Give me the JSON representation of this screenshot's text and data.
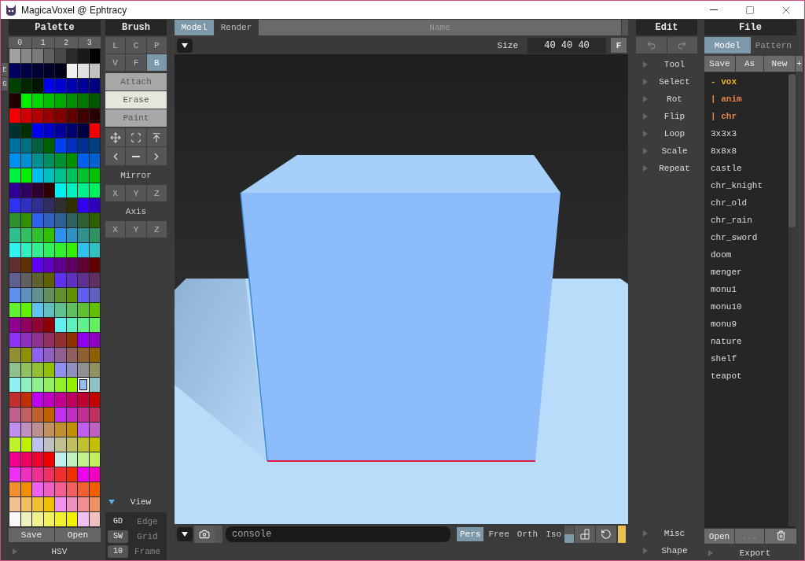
{
  "window": {
    "title": "MagicaVoxel @ Ephtracy"
  },
  "palette": {
    "title": "Palette",
    "side_tabs": [
      "E",
      "G"
    ],
    "tabs": [
      "0",
      "1",
      "2",
      "3"
    ],
    "rows": [
      {
        "swatches": [
          {
            "color": "#a0a0a0",
            "selected": false
          },
          {
            "color": "#888888",
            "selected": false
          },
          {
            "color": "#7a7a7a",
            "selected": false
          },
          {
            "color": "#606060",
            "selected": false
          },
          {
            "color": "#4a4a4a",
            "selected": false
          },
          {
            "color": "#2a2a2a",
            "selected": false
          },
          {
            "color": "#181818",
            "selected": false
          },
          {
            "color": "#000000",
            "selected": false
          }
        ]
      },
      {
        "swatches": [
          {
            "color": "#000060",
            "selected": false
          },
          {
            "color": "#000048",
            "selected": false
          },
          {
            "color": "#000038",
            "selected": false
          },
          {
            "color": "#000028",
            "selected": false
          },
          {
            "color": "#000018",
            "selected": false
          },
          {
            "color": "#f0f0f0",
            "selected": false
          },
          {
            "color": "#e0e0e0",
            "selected": false
          },
          {
            "color": "#c0c0c0",
            "selected": false
          }
        ]
      },
      {
        "swatches": [
          {
            "color": "#004000",
            "selected": false
          },
          {
            "color": "#002800",
            "selected": false
          },
          {
            "color": "#001800",
            "selected": false
          },
          {
            "color": "#0000f0",
            "selected": false
          },
          {
            "color": "#0000d0",
            "selected": false
          },
          {
            "color": "#0000b0",
            "selected": false
          },
          {
            "color": "#000098",
            "selected": false
          },
          {
            "color": "#000080",
            "selected": false
          }
        ]
      },
      {
        "swatches": [
          {
            "color": "#200000",
            "selected": false
          },
          {
            "color": "#00f000",
            "selected": false
          },
          {
            "color": "#00d800",
            "selected": false
          },
          {
            "color": "#00c000",
            "selected": false
          },
          {
            "color": "#00a800",
            "selected": false
          },
          {
            "color": "#009000",
            "selected": false
          },
          {
            "color": "#007800",
            "selected": false
          },
          {
            "color": "#005800",
            "selected": false
          }
        ]
      },
      {
        "swatches": [
          {
            "color": "#f00000",
            "selected": false
          },
          {
            "color": "#d00000",
            "selected": false
          },
          {
            "color": "#b00000",
            "selected": false
          },
          {
            "color": "#980000",
            "selected": false
          },
          {
            "color": "#800000",
            "selected": false
          },
          {
            "color": "#600000",
            "selected": false
          },
          {
            "color": "#400000",
            "selected": false
          },
          {
            "color": "#280000",
            "selected": false
          }
        ]
      },
      {
        "swatches": [
          {
            "color": "#003030",
            "selected": false
          },
          {
            "color": "#003000",
            "selected": false
          },
          {
            "color": "#0000f8",
            "selected": false
          },
          {
            "color": "#0000c8",
            "selected": false
          },
          {
            "color": "#000098",
            "selected": false
          },
          {
            "color": "#000070",
            "selected": false
          },
          {
            "color": "#000040",
            "selected": false
          },
          {
            "color": "#f00000",
            "selected": false
          }
        ]
      },
      {
        "swatches": [
          {
            "color": "#0070a0",
            "selected": false
          },
          {
            "color": "#007080",
            "selected": false
          },
          {
            "color": "#006040",
            "selected": false
          },
          {
            "color": "#006000",
            "selected": false
          },
          {
            "color": "#0040f0",
            "selected": false
          },
          {
            "color": "#0030c0",
            "selected": false
          },
          {
            "color": "#003090",
            "selected": false
          },
          {
            "color": "#004080",
            "selected": false
          }
        ]
      },
      {
        "swatches": [
          {
            "color": "#0090f0",
            "selected": false
          },
          {
            "color": "#0090d0",
            "selected": false
          },
          {
            "color": "#009090",
            "selected": false
          },
          {
            "color": "#009060",
            "selected": false
          },
          {
            "color": "#009030",
            "selected": false
          },
          {
            "color": "#009000",
            "selected": false
          },
          {
            "color": "#0060f0",
            "selected": false
          },
          {
            "color": "#0060d0",
            "selected": false
          }
        ]
      },
      {
        "swatches": [
          {
            "color": "#00f040",
            "selected": false
          },
          {
            "color": "#00f000",
            "selected": false
          },
          {
            "color": "#00c0f0",
            "selected": false
          },
          {
            "color": "#00c0c0",
            "selected": false
          },
          {
            "color": "#00c090",
            "selected": false
          },
          {
            "color": "#00c060",
            "selected": false
          },
          {
            "color": "#00c030",
            "selected": false
          },
          {
            "color": "#00c000",
            "selected": false
          }
        ]
      },
      {
        "swatches": [
          {
            "color": "#300090",
            "selected": false
          },
          {
            "color": "#300060",
            "selected": false
          },
          {
            "color": "#300030",
            "selected": false
          },
          {
            "color": "#300000",
            "selected": false
          },
          {
            "color": "#00f0f0",
            "selected": false
          },
          {
            "color": "#00f0c0",
            "selected": false
          },
          {
            "color": "#00f090",
            "selected": false
          },
          {
            "color": "#00f060",
            "selected": false
          }
        ]
      },
      {
        "swatches": [
          {
            "color": "#3030f0",
            "selected": false
          },
          {
            "color": "#3030c0",
            "selected": false
          },
          {
            "color": "#303090",
            "selected": false
          },
          {
            "color": "#303060",
            "selected": false
          },
          {
            "color": "#303030",
            "selected": false
          },
          {
            "color": "#303000",
            "selected": false
          },
          {
            "color": "#3000f0",
            "selected": false
          },
          {
            "color": "#3000c0",
            "selected": false
          }
        ]
      },
      {
        "swatches": [
          {
            "color": "#309030",
            "selected": false
          },
          {
            "color": "#309000",
            "selected": false
          },
          {
            "color": "#3060f0",
            "selected": false
          },
          {
            "color": "#3060c0",
            "selected": false
          },
          {
            "color": "#306090",
            "selected": false
          },
          {
            "color": "#306060",
            "selected": false
          },
          {
            "color": "#306030",
            "selected": false
          },
          {
            "color": "#306000",
            "selected": false
          }
        ]
      },
      {
        "swatches": [
          {
            "color": "#30c090",
            "selected": false
          },
          {
            "color": "#30c060",
            "selected": false
          },
          {
            "color": "#30c030",
            "selected": false
          },
          {
            "color": "#30c000",
            "selected": false
          },
          {
            "color": "#3090f0",
            "selected": false
          },
          {
            "color": "#3090c0",
            "selected": false
          },
          {
            "color": "#309090",
            "selected": false
          },
          {
            "color": "#309060",
            "selected": false
          }
        ]
      },
      {
        "swatches": [
          {
            "color": "#30f0f0",
            "selected": false
          },
          {
            "color": "#30f0c0",
            "selected": false
          },
          {
            "color": "#30f090",
            "selected": false
          },
          {
            "color": "#30f060",
            "selected": false
          },
          {
            "color": "#30f030",
            "selected": false
          },
          {
            "color": "#30f000",
            "selected": false
          },
          {
            "color": "#30c0f0",
            "selected": false
          },
          {
            "color": "#30c0c0",
            "selected": false
          }
        ]
      },
      {
        "swatches": [
          {
            "color": "#603030",
            "selected": false
          },
          {
            "color": "#603000",
            "selected": false
          },
          {
            "color": "#6000f0",
            "selected": false
          },
          {
            "color": "#6000c0",
            "selected": false
          },
          {
            "color": "#600090",
            "selected": false
          },
          {
            "color": "#600060",
            "selected": false
          },
          {
            "color": "#600030",
            "selected": false
          },
          {
            "color": "#600000",
            "selected": false
          }
        ]
      },
      {
        "swatches": [
          {
            "color": "#606090",
            "selected": false
          },
          {
            "color": "#606060",
            "selected": false
          },
          {
            "color": "#606030",
            "selected": false
          },
          {
            "color": "#606000",
            "selected": false
          },
          {
            "color": "#6030f0",
            "selected": false
          },
          {
            "color": "#6030c0",
            "selected": false
          },
          {
            "color": "#603090",
            "selected": false
          },
          {
            "color": "#603060",
            "selected": false
          }
        ]
      },
      {
        "swatches": [
          {
            "color": "#6090f0",
            "selected": false
          },
          {
            "color": "#6090c0",
            "selected": false
          },
          {
            "color": "#609090",
            "selected": false
          },
          {
            "color": "#609060",
            "selected": false
          },
          {
            "color": "#609030",
            "selected": false
          },
          {
            "color": "#609000",
            "selected": false
          },
          {
            "color": "#6060f0",
            "selected": false
          },
          {
            "color": "#6060c0",
            "selected": false
          }
        ]
      },
      {
        "swatches": [
          {
            "color": "#60f030",
            "selected": false
          },
          {
            "color": "#60f000",
            "selected": false
          },
          {
            "color": "#60c0f0",
            "selected": false
          },
          {
            "color": "#60c0c0",
            "selected": false
          },
          {
            "color": "#60c090",
            "selected": false
          },
          {
            "color": "#60c060",
            "selected": false
          },
          {
            "color": "#60c030",
            "selected": false
          },
          {
            "color": "#60c000",
            "selected": false
          }
        ]
      },
      {
        "swatches": [
          {
            "color": "#900090",
            "selected": false
          },
          {
            "color": "#900060",
            "selected": false
          },
          {
            "color": "#900030",
            "selected": false
          },
          {
            "color": "#900000",
            "selected": false
          },
          {
            "color": "#60f0f0",
            "selected": false
          },
          {
            "color": "#60f0c0",
            "selected": false
          },
          {
            "color": "#60f090",
            "selected": false
          },
          {
            "color": "#60f060",
            "selected": false
          }
        ]
      },
      {
        "swatches": [
          {
            "color": "#9030f0",
            "selected": false
          },
          {
            "color": "#9030c0",
            "selected": false
          },
          {
            "color": "#903090",
            "selected": false
          },
          {
            "color": "#903060",
            "selected": false
          },
          {
            "color": "#903030",
            "selected": false
          },
          {
            "color": "#903000",
            "selected": false
          },
          {
            "color": "#9000f0",
            "selected": false
          },
          {
            "color": "#9000c0",
            "selected": false
          }
        ]
      },
      {
        "swatches": [
          {
            "color": "#909030",
            "selected": false
          },
          {
            "color": "#909000",
            "selected": false
          },
          {
            "color": "#9060f0",
            "selected": false
          },
          {
            "color": "#9060c0",
            "selected": false
          },
          {
            "color": "#906090",
            "selected": false
          },
          {
            "color": "#906060",
            "selected": false
          },
          {
            "color": "#906030",
            "selected": false
          },
          {
            "color": "#906000",
            "selected": false
          }
        ]
      },
      {
        "swatches": [
          {
            "color": "#90c090",
            "selected": false
          },
          {
            "color": "#90c060",
            "selected": false
          },
          {
            "color": "#90c030",
            "selected": false
          },
          {
            "color": "#90c000",
            "selected": false
          },
          {
            "color": "#9090f0",
            "selected": false
          },
          {
            "color": "#9090c0",
            "selected": false
          },
          {
            "color": "#909090",
            "selected": false
          },
          {
            "color": "#909060",
            "selected": false
          }
        ]
      },
      {
        "swatches": [
          {
            "color": "#90f0f0",
            "selected": false
          },
          {
            "color": "#90f0c0",
            "selected": false
          },
          {
            "color": "#90f090",
            "selected": false
          },
          {
            "color": "#90f060",
            "selected": false
          },
          {
            "color": "#90f030",
            "selected": false
          },
          {
            "color": "#90f000",
            "selected": false
          },
          {
            "color": "#90c0f0",
            "selected": true
          },
          {
            "color": "#90c0c0",
            "selected": false
          }
        ]
      },
      {
        "swatches": [
          {
            "color": "#c03030",
            "selected": false
          },
          {
            "color": "#c03000",
            "selected": false
          },
          {
            "color": "#c000f0",
            "selected": false
          },
          {
            "color": "#c000c0",
            "selected": false
          },
          {
            "color": "#c00090",
            "selected": false
          },
          {
            "color": "#c00060",
            "selected": false
          },
          {
            "color": "#c00030",
            "selected": false
          },
          {
            "color": "#c00000",
            "selected": false
          }
        ]
      },
      {
        "swatches": [
          {
            "color": "#c06090",
            "selected": false
          },
          {
            "color": "#c06060",
            "selected": false
          },
          {
            "color": "#c06030",
            "selected": false
          },
          {
            "color": "#c06000",
            "selected": false
          },
          {
            "color": "#c030f0",
            "selected": false
          },
          {
            "color": "#c030c0",
            "selected": false
          },
          {
            "color": "#c03090",
            "selected": false
          },
          {
            "color": "#c03060",
            "selected": false
          }
        ]
      },
      {
        "swatches": [
          {
            "color": "#c090f0",
            "selected": false
          },
          {
            "color": "#c090c0",
            "selected": false
          },
          {
            "color": "#c09090",
            "selected": false
          },
          {
            "color": "#c09060",
            "selected": false
          },
          {
            "color": "#c09030",
            "selected": false
          },
          {
            "color": "#c09000",
            "selected": false
          },
          {
            "color": "#c060f0",
            "selected": false
          },
          {
            "color": "#c060c0",
            "selected": false
          }
        ]
      },
      {
        "swatches": [
          {
            "color": "#c0f030",
            "selected": false
          },
          {
            "color": "#c0f000",
            "selected": false
          },
          {
            "color": "#c0c0f0",
            "selected": false
          },
          {
            "color": "#c0c0c0",
            "selected": false
          },
          {
            "color": "#c0c090",
            "selected": false
          },
          {
            "color": "#c0c060",
            "selected": false
          },
          {
            "color": "#c0c030",
            "selected": false
          },
          {
            "color": "#c0c000",
            "selected": false
          }
        ]
      },
      {
        "swatches": [
          {
            "color": "#f00090",
            "selected": false
          },
          {
            "color": "#f00060",
            "selected": false
          },
          {
            "color": "#f00030",
            "selected": false
          },
          {
            "color": "#f00000",
            "selected": false
          },
          {
            "color": "#c0f0f0",
            "selected": false
          },
          {
            "color": "#c0f0c0",
            "selected": false
          },
          {
            "color": "#c0f090",
            "selected": false
          },
          {
            "color": "#c0f060",
            "selected": false
          }
        ]
      },
      {
        "swatches": [
          {
            "color": "#f030f0",
            "selected": false
          },
          {
            "color": "#f030c0",
            "selected": false
          },
          {
            "color": "#f03090",
            "selected": false
          },
          {
            "color": "#f03060",
            "selected": false
          },
          {
            "color": "#f03030",
            "selected": false
          },
          {
            "color": "#f03000",
            "selected": false
          },
          {
            "color": "#f000f0",
            "selected": false
          },
          {
            "color": "#f000c0",
            "selected": false
          }
        ]
      },
      {
        "swatches": [
          {
            "color": "#f09030",
            "selected": false
          },
          {
            "color": "#f09000",
            "selected": false
          },
          {
            "color": "#f060f0",
            "selected": false
          },
          {
            "color": "#f060c0",
            "selected": false
          },
          {
            "color": "#f06090",
            "selected": false
          },
          {
            "color": "#f06060",
            "selected": false
          },
          {
            "color": "#f06030",
            "selected": false
          },
          {
            "color": "#f06000",
            "selected": false
          }
        ]
      },
      {
        "swatches": [
          {
            "color": "#f0c090",
            "selected": false
          },
          {
            "color": "#f0c060",
            "selected": false
          },
          {
            "color": "#f0c030",
            "selected": false
          },
          {
            "color": "#f0c000",
            "selected": false
          },
          {
            "color": "#f090f0",
            "selected": false
          },
          {
            "color": "#f090c0",
            "selected": false
          },
          {
            "color": "#f09090",
            "selected": false
          },
          {
            "color": "#f09060",
            "selected": false
          }
        ]
      },
      {
        "swatches": [
          {
            "color": "#f8f8f8",
            "selected": false
          },
          {
            "color": "#f0f0c0",
            "selected": false
          },
          {
            "color": "#f0f090",
            "selected": false
          },
          {
            "color": "#f0f060",
            "selected": false
          },
          {
            "color": "#f0f030",
            "selected": false
          },
          {
            "color": "#f0f000",
            "selected": false
          },
          {
            "color": "#f0c0f0",
            "selected": false
          },
          {
            "color": "#f0c0c0",
            "selected": false
          }
        ]
      }
    ],
    "buttons": [
      "Save",
      "Open"
    ],
    "hsv": {
      "label": "HSV",
      "expanded": false
    }
  },
  "brush": {
    "title": "Brush",
    "shapes": [
      {
        "label": "L",
        "selected": false
      },
      {
        "label": "C",
        "selected": false
      },
      {
        "label": "P",
        "selected": false
      },
      {
        "label": "V",
        "selected": false
      },
      {
        "label": "F",
        "selected": false
      },
      {
        "label": "B",
        "selected": true
      }
    ],
    "modes": [
      {
        "label": "Attach",
        "selected": false
      },
      {
        "label": "Erase",
        "selected": true
      },
      {
        "label": "Paint",
        "selected": false
      }
    ],
    "mirror": {
      "label": "Mirror",
      "axes": [
        "X",
        "Y",
        "Z"
      ]
    },
    "axis": {
      "label": "Axis",
      "axes": [
        "X",
        "Y",
        "Z"
      ]
    },
    "view": {
      "label": "View",
      "expanded": true,
      "rows": [
        {
          "kind": "toggle",
          "key": "GD",
          "label": "Edge"
        },
        {
          "kind": "number",
          "key": "SW",
          "label": "Grid"
        },
        {
          "kind": "number",
          "key": "10",
          "label": "Frame"
        }
      ]
    }
  },
  "viewport": {
    "tabs": [
      {
        "label": "Model",
        "selected": true
      },
      {
        "label": "Render",
        "selected": false
      }
    ],
    "name_placeholder": "Name",
    "size_label": "Size",
    "size_value": "40 40 40",
    "fit_button": "F",
    "console_placeholder": "console",
    "projections": [
      {
        "label": "Pers",
        "selected": true
      },
      {
        "label": "Free",
        "selected": false
      },
      {
        "label": "Orth",
        "selected": false
      },
      {
        "label": "Iso",
        "selected": false
      }
    ]
  },
  "edit": {
    "title": "Edit",
    "tools": [
      {
        "label": "Tool",
        "expanded": false
      },
      {
        "label": "Select",
        "expanded": false
      },
      {
        "label": "Rot",
        "expanded": false
      },
      {
        "label": "Flip",
        "expanded": false
      },
      {
        "label": "Loop",
        "expanded": false
      },
      {
        "label": "Scale",
        "expanded": false
      },
      {
        "label": "Repeat",
        "expanded": false
      }
    ],
    "bottom": [
      {
        "label": "Misc",
        "expanded": false
      },
      {
        "label": "Shape",
        "expanded": false
      }
    ]
  },
  "file": {
    "title": "File",
    "tabs": [
      {
        "label": "Model",
        "selected": true
      },
      {
        "label": "Pattern",
        "selected": false
      }
    ],
    "buttons": [
      "Save",
      "As",
      "New",
      "+"
    ],
    "items": [
      {
        "name": "- vox",
        "kind": "open-folder"
      },
      {
        "name": "| anim",
        "kind": "folder"
      },
      {
        "name": "| chr",
        "kind": "folder"
      },
      {
        "name": "3x3x3",
        "kind": "file"
      },
      {
        "name": "8x8x8",
        "kind": "file"
      },
      {
        "name": "castle",
        "kind": "file"
      },
      {
        "name": "chr_knight",
        "kind": "file"
      },
      {
        "name": "chr_old",
        "kind": "file"
      },
      {
        "name": "chr_rain",
        "kind": "file"
      },
      {
        "name": "chr_sword",
        "kind": "file"
      },
      {
        "name": "doom",
        "kind": "file"
      },
      {
        "name": "menger",
        "kind": "file"
      },
      {
        "name": "monu1",
        "kind": "file"
      },
      {
        "name": "monu10",
        "kind": "file"
      },
      {
        "name": "monu9",
        "kind": "file"
      },
      {
        "name": "nature",
        "kind": "file"
      },
      {
        "name": "shelf",
        "kind": "file"
      },
      {
        "name": "teapot",
        "kind": "file"
      }
    ],
    "bottom_buttons": [
      "Open",
      "..."
    ],
    "export": {
      "label": "Export",
      "expanded": false
    }
  }
}
